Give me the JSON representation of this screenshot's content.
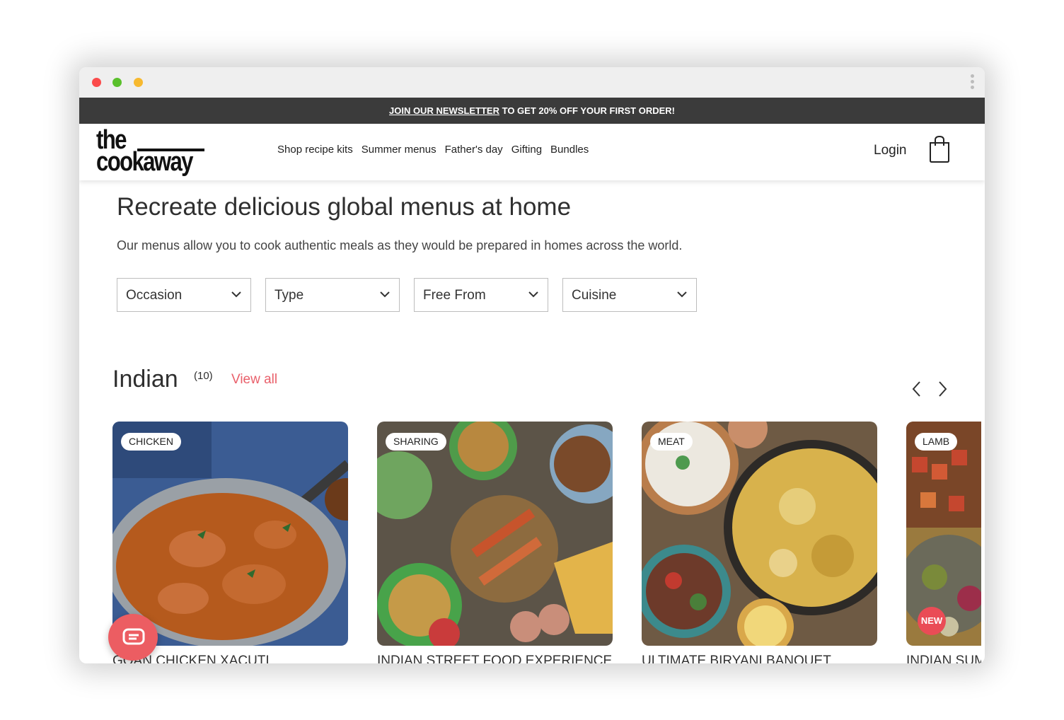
{
  "window": {
    "controls": [
      "close",
      "minimize",
      "maximize"
    ]
  },
  "banner": {
    "link_text": "JOIN OUR NEWSLETTER",
    "rest_text": " TO GET 20% OFF YOUR FIRST ORDER!"
  },
  "header": {
    "logo_top": "the",
    "logo_bottom": "cookaway",
    "nav": [
      "Shop recipe kits",
      "Summer menus",
      "Father's day",
      "Gifting",
      "Bundles"
    ],
    "login": "Login",
    "cart_icon": "shopping-bag-icon"
  },
  "hero": {
    "headline": "Recreate delicious global menus at home",
    "subline": "Our menus allow you to cook authentic meals as they would be prepared in homes across the world."
  },
  "filters": [
    {
      "label": "Occasion"
    },
    {
      "label": "Type"
    },
    {
      "label": "Free From"
    },
    {
      "label": "Cuisine"
    }
  ],
  "section": {
    "title": "Indian",
    "count": "(10)",
    "view_all": "View all",
    "prev_icon": "chevron-left-icon",
    "next_icon": "chevron-right-icon"
  },
  "cards": [
    {
      "tag": "CHICKEN",
      "title": "GOAN CHICKEN XACUTI"
    },
    {
      "tag": "SHARING",
      "title": "INDIAN STREET FOOD EXPERIENCE"
    },
    {
      "tag": "MEAT",
      "title": "ULTIMATE BIRYANI BANQUET"
    },
    {
      "tag": "LAMB",
      "title": "INDIAN SUM",
      "badge": "NEW"
    }
  ],
  "chat": {
    "icon": "chat-bubble-icon"
  },
  "colors": {
    "accent": "#e9606b",
    "banner_bg": "#3b3b3b",
    "chat_bg": "#ec5d62",
    "new_badge": "#ea4c56"
  }
}
